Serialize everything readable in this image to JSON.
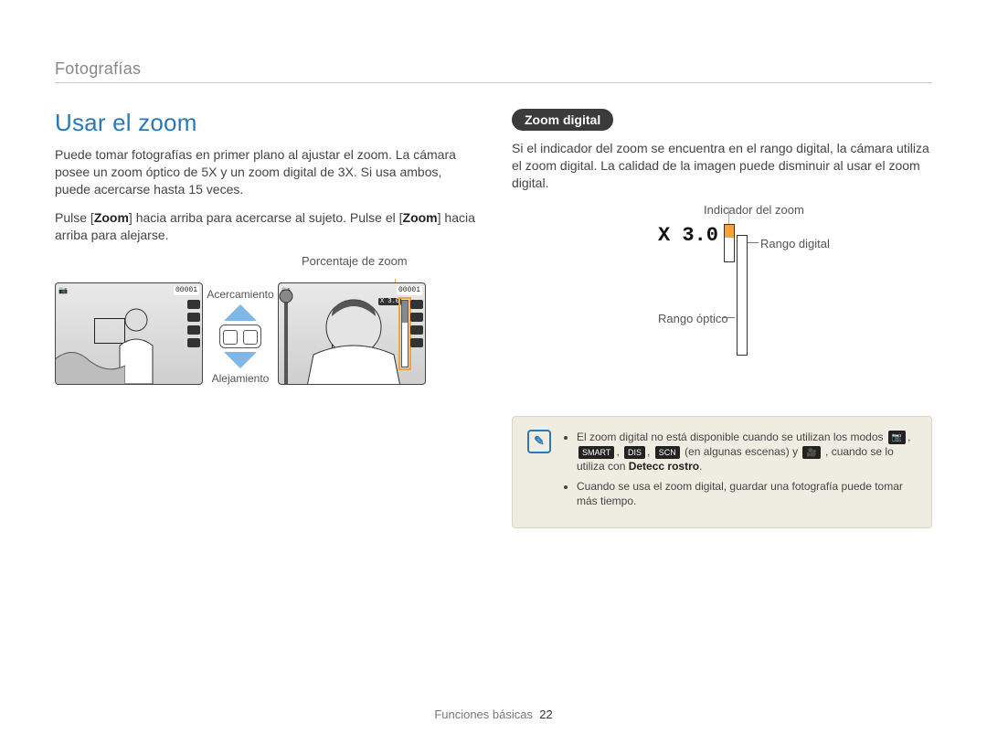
{
  "breadcrumb": "Fotografías",
  "left": {
    "heading": "Usar el zoom",
    "p1": "Puede tomar fotografías en primer plano al ajustar el zoom. La cámara posee un zoom óptico de 5X y un zoom digital de 3X. Si usa ambos, puede acercarse hasta 15 veces.",
    "p2_pre": "Pulse [",
    "p2_bold1": "Zoom",
    "p2_mid": "] hacia arriba para acercarse al sujeto. Pulse el [",
    "p2_bold2": "Zoom",
    "p2_post": "] hacia arriba para alejarse.",
    "fig": {
      "percentage_label": "Porcentaje de zoom",
      "zoom_in_label": "Acercamiento",
      "zoom_out_label": "Alejamiento",
      "hud_counter": "00001",
      "zoom_readout": "X 3.0"
    }
  },
  "right": {
    "pill": "Zoom digital",
    "p1": "Si el indicador del zoom se encuentra en el rango digital, la cámara utiliza el zoom digital. La calidad de la imagen puede disminuir al usar el zoom digital.",
    "diagram": {
      "x_value": "X 3.0",
      "indicator_label": "Indicador del zoom",
      "digital_label": "Rango digital",
      "optical_label": "Rango óptico"
    },
    "note": {
      "bullet1_a": "El zoom digital no está disponible cuando se utilizan los modos ",
      "bullet1_b": " (en algunas escenas) y ",
      "bullet1_c": ", cuando se lo utiliza con ",
      "bullet1_bold": "Detecc rostro",
      "bullet1_d": ".",
      "bullet2": "Cuando se usa el zoom digital, guardar una fotografía puede tomar más tiempo."
    }
  },
  "footer": {
    "section": "Funciones básicas",
    "page": "22"
  }
}
